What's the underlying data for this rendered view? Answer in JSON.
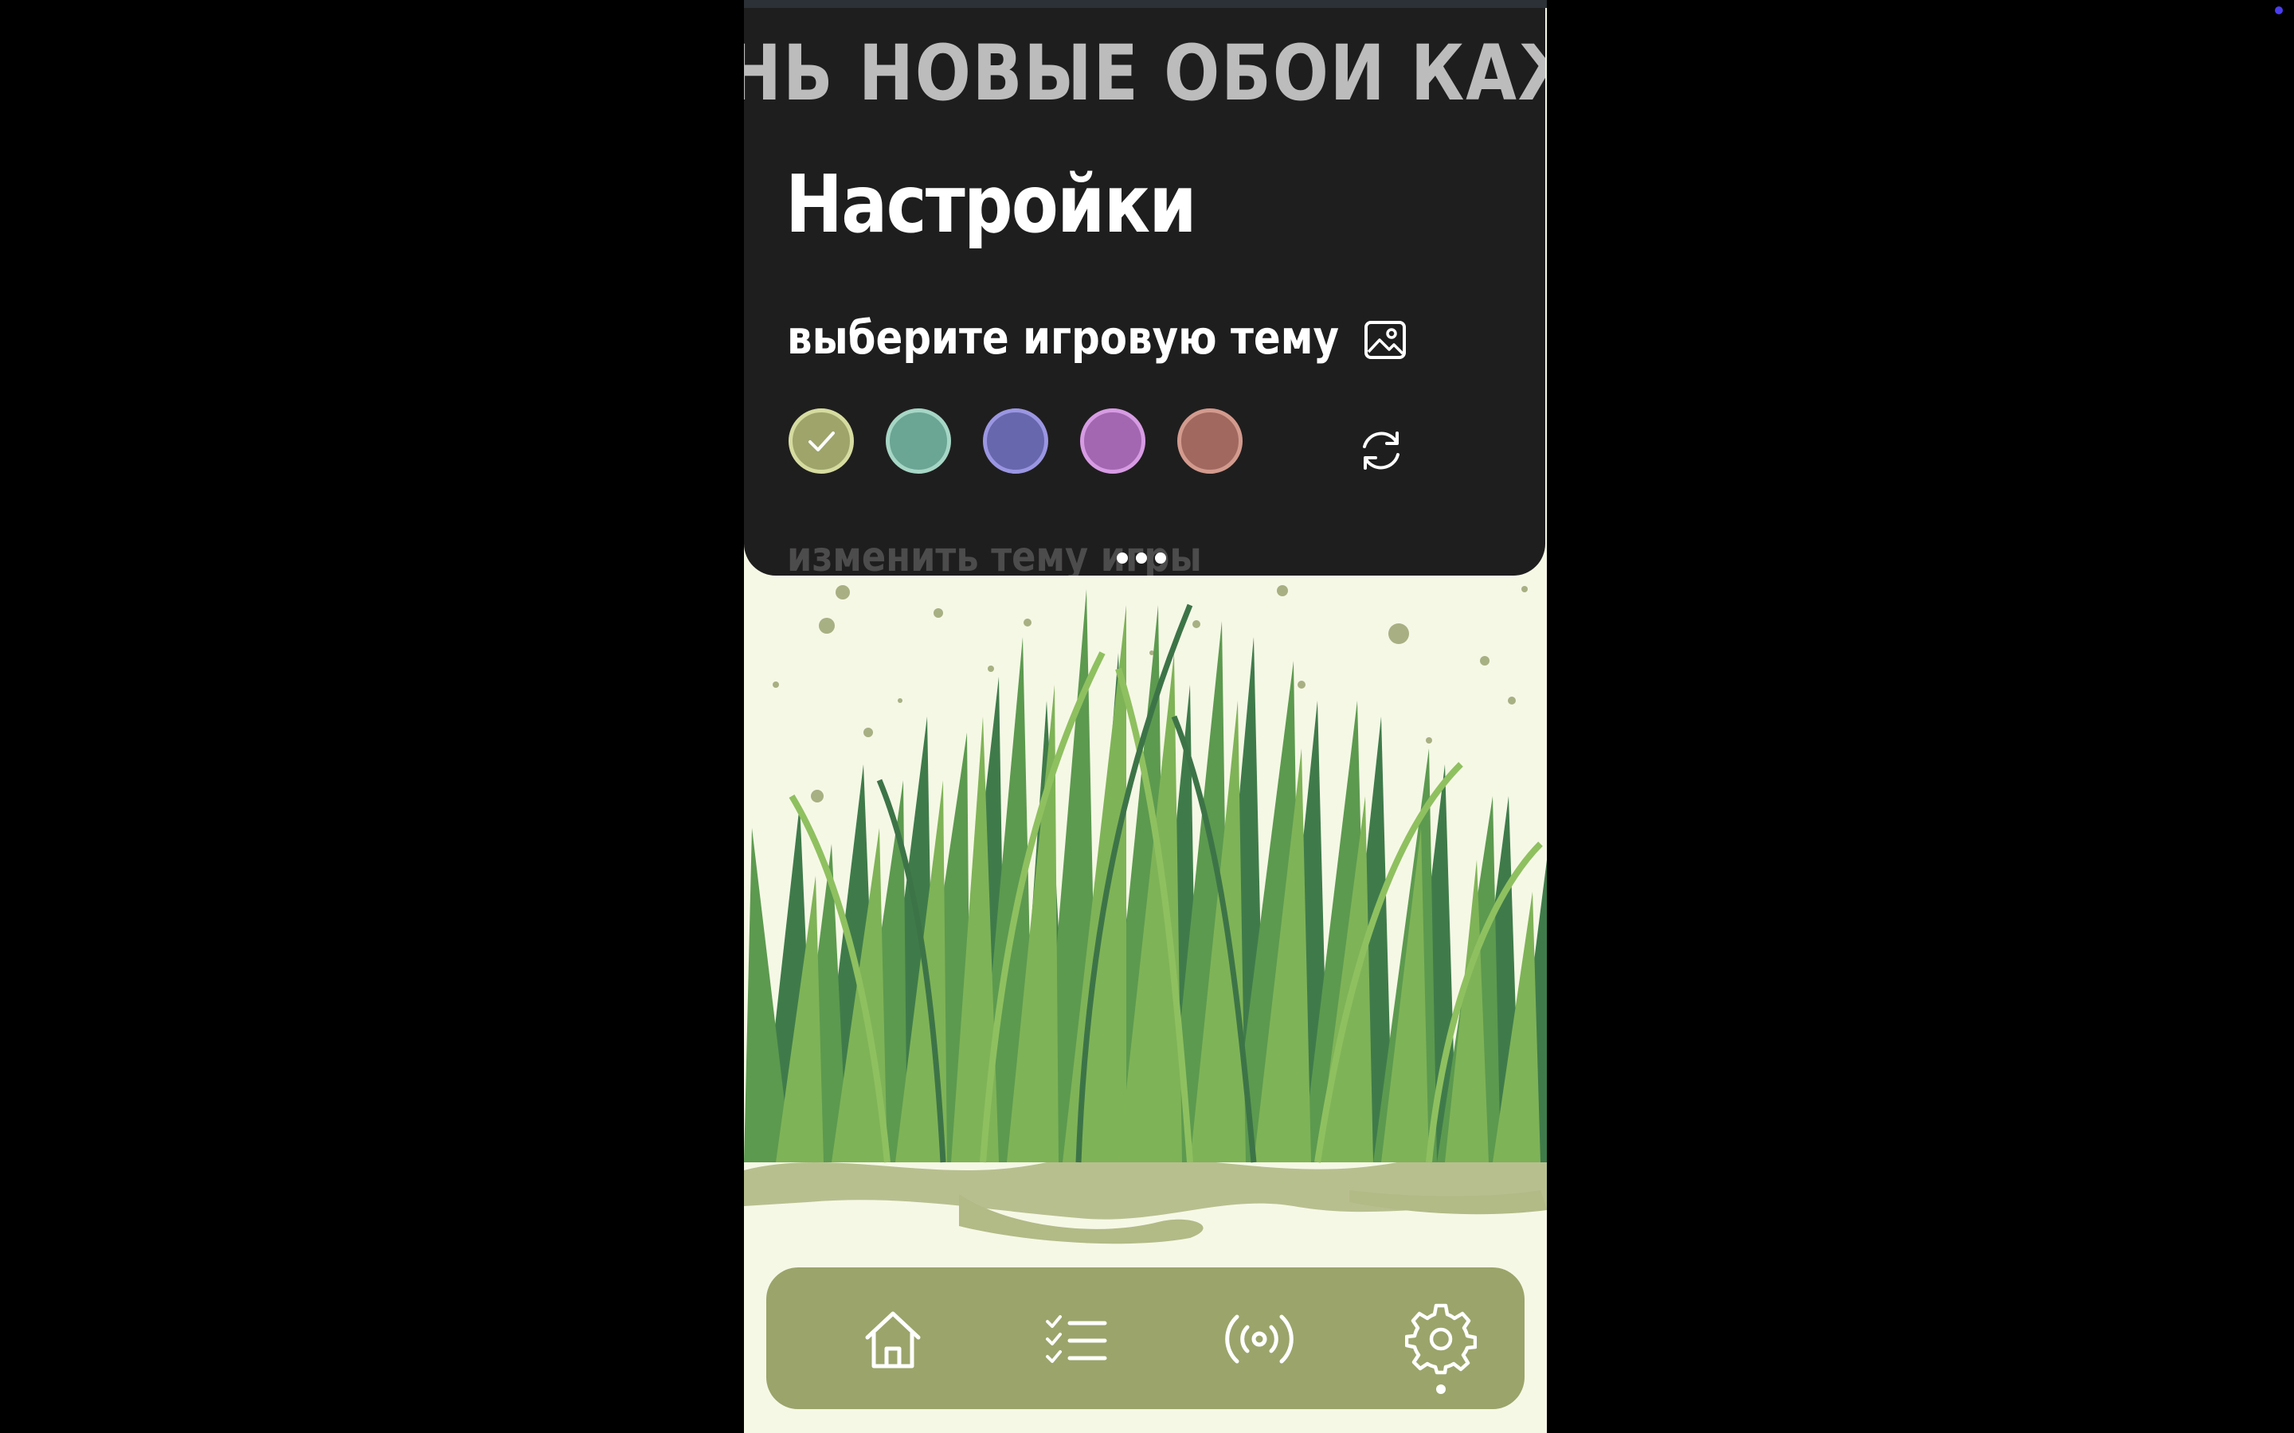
{
  "marquee": {
    "text": "НЬ НОВЫЕ ОБОИ КАЖДЫЙ"
  },
  "settings": {
    "title": "Настройки",
    "theme_label": "выберите игровую тему",
    "change_theme_label": "изменить тему игры",
    "wallpaper_icon": "image-icon",
    "refresh_icon": "refresh-icon",
    "themes": [
      {
        "color": "#9ea46a",
        "border": "#d6dca0",
        "selected": true
      },
      {
        "color": "#6ba594",
        "border": "#a6d6c6",
        "selected": false
      },
      {
        "color": "#6767ad",
        "border": "#9b96e2",
        "selected": false
      },
      {
        "color": "#a267b0",
        "border": "#d79be4",
        "selected": false
      },
      {
        "color": "#a1685f",
        "border": "#d39a8e",
        "selected": false
      }
    ]
  },
  "nav": {
    "items": [
      {
        "icon": "home-icon",
        "active": false
      },
      {
        "icon": "checklist-icon",
        "active": false
      },
      {
        "icon": "broadcast-icon",
        "active": false
      },
      {
        "icon": "gear-icon",
        "active": true
      }
    ],
    "bar_color": "#9ba46a"
  }
}
